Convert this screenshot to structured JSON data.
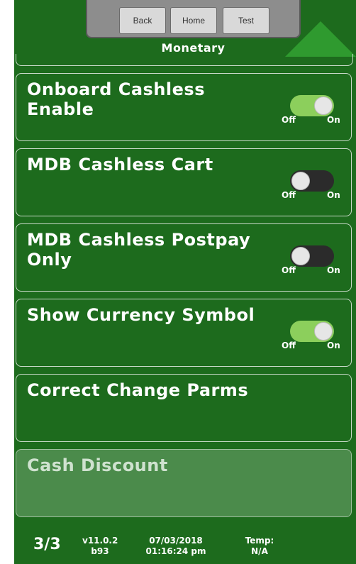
{
  "nav": {
    "back_label": "Back",
    "home_label": "Home",
    "test_label": "Test",
    "title": "Monetary",
    "up_arrow_icon": "triangle-up-icon"
  },
  "items": [
    {
      "label": "Onboard Cashless Enable",
      "toggle_state": "on",
      "off_label": "Off",
      "on_label": "On"
    },
    {
      "label": "MDB Cashless Cart",
      "toggle_state": "off",
      "off_label": "Off",
      "on_label": "On"
    },
    {
      "label": "MDB Cashless Postpay Only",
      "toggle_state": "off",
      "off_label": "Off",
      "on_label": "On"
    },
    {
      "label": "Show Currency Symbol",
      "toggle_state": "on",
      "off_label": "Off",
      "on_label": "On"
    },
    {
      "label": "Correct Change Parms"
    },
    {
      "label": "Cash Discount",
      "state": "disabled"
    }
  ],
  "footer": {
    "page": "3/3",
    "version": "v11.0.2",
    "build": "b93",
    "date": "07/03/2018",
    "time": "01:16:24 pm",
    "temp_label": "Temp:",
    "temp_value": "N/A"
  },
  "colors": {
    "background": "#1d6b1d",
    "toggle_on": "#8ccf5c",
    "toggle_off": "#2b2b2b",
    "up_arrow": "#2f9a2f"
  }
}
